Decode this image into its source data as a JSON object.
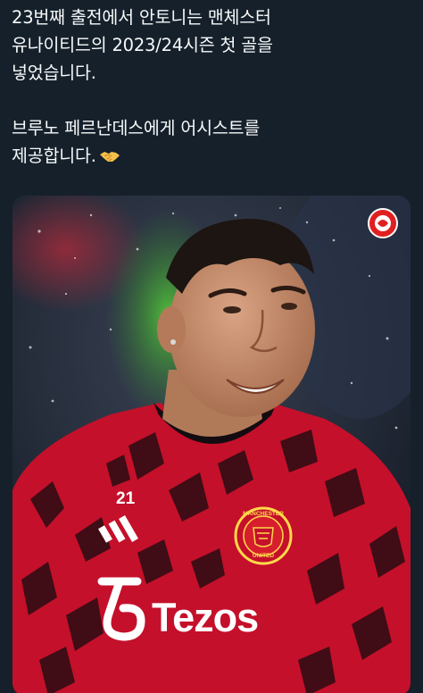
{
  "post": {
    "line1": "23번째 출전에서 안토니는 맨체스터",
    "line2": "유나이티드의 2023/24시즌 첫 골을",
    "line3": "넣었습니다.",
    "line4": "브루노 페르난데스에게 어시스트를",
    "line5": "제공합니다.",
    "emoji_icon": "handshake-icon"
  },
  "media": {
    "kit_number": "21",
    "sponsor": "Tezos",
    "crest_top": "MANCHESTER",
    "crest_bottom": "UNITED",
    "badge_icon": "publisher-logo-icon",
    "colors": {
      "shirt_red": "#c4102b",
      "shirt_dark": "#1a0a0e",
      "pitch_green": "#3fa83c",
      "background": "#15202b"
    }
  }
}
